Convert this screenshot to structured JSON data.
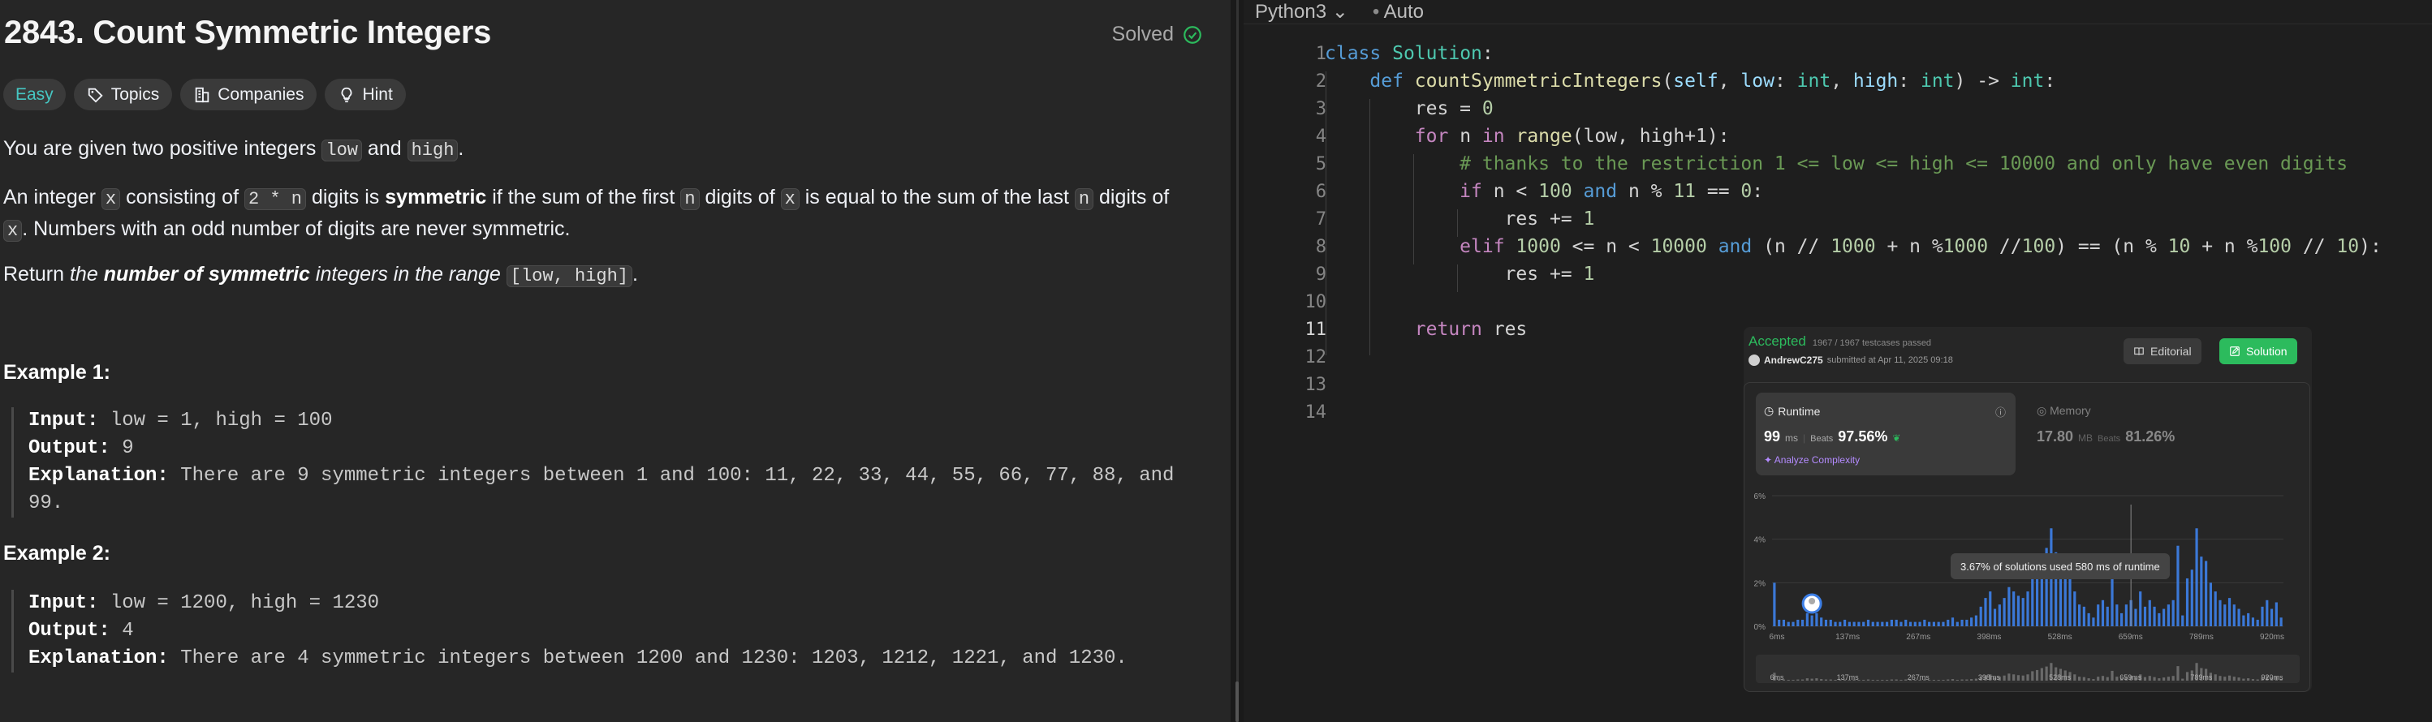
{
  "problem": {
    "title": "2843. Count Symmetric Integers",
    "solved_label": "Solved",
    "tags": {
      "difficulty": "Easy",
      "topics": "Topics",
      "companies": "Companies",
      "hint": "Hint"
    },
    "desc1": {
      "t1": "You are given two positive integers ",
      "c1": "low",
      "t2": " and ",
      "c2": "high",
      "t3": "."
    },
    "desc2": {
      "t1": "An integer ",
      "c1": "x",
      "t2": " consisting of ",
      "c2": "2 * n",
      "t3": " digits is ",
      "b1": "symmetric",
      "t4": " if the sum of the first ",
      "c3": "n",
      "t5": " digits of ",
      "c4": "x",
      "t6": " is equal to the sum of the last ",
      "c5": "n",
      "t7": " digits of ",
      "c6": "x",
      "t8": ". Numbers with an odd number of digits are never symmetric."
    },
    "desc3": {
      "t1": "Return ",
      "i1": "the ",
      "b1": "number of symmetric",
      "i2": " integers in the range ",
      "c1": "[low, high]",
      "t2": "."
    },
    "examples": [
      {
        "heading": "Example 1:",
        "input_label": "Input:",
        "input": " low = 1, high = 100",
        "output_label": "Output:",
        "output": " 9",
        "expl_label": "Explanation:",
        "expl": " There are 9 symmetric integers between 1 and 100: 11, 22, 33, 44, 55, 66, 77, 88, and",
        "expl2": "99."
      },
      {
        "heading": "Example 2:",
        "input_label": "Input:",
        "input": " low = 1200, high = 1230",
        "output_label": "Output:",
        "output": " 4",
        "expl_label": "Explanation:",
        "expl": " There are 4 symmetric integers between 1200 and 1230: 1203, 1212, 1221, and 1230."
      }
    ]
  },
  "editor": {
    "language": "Python3",
    "mode": "Auto",
    "line_numbers": [
      "1",
      "2",
      "3",
      "4",
      "5",
      "6",
      "7",
      "8",
      "9",
      "10",
      "11",
      "12",
      "13",
      "14"
    ],
    "current_line": "11",
    "code": {
      "l1": {
        "kw": "class",
        "name": "Solution",
        "rest": ":"
      },
      "l2": {
        "kw": "def",
        "fn": "countSymmetricIntegers",
        "p1": "self",
        "p2": "low",
        "t": "int",
        "p3": "high",
        "arrow": "->"
      },
      "l3": {
        "a": "res = ",
        "n": "0"
      },
      "l4": {
        "kw": "for",
        "v": "n",
        "kin": "in",
        "fn": "range",
        "args": "(low, high+1):"
      },
      "l5": {
        "cm": "# thanks to the restriction 1 <= low <= high <= 10000 and only have even digits"
      },
      "l6": {
        "kw": "if",
        "a": "n < ",
        "n1": "100",
        "op": "and",
        "b": "n % ",
        "n2": "11",
        "c": " == ",
        "n3": "0",
        "d": ":"
      },
      "l7": {
        "a": "res += ",
        "n": "1"
      },
      "l8": {
        "kw": "elif",
        "n1": "1000",
        "a": " <= n < ",
        "n2": "10000",
        "op": "and",
        "b": "(n // ",
        "n3": "1000",
        "c": " + n %",
        "n4": "1000",
        "d": " //",
        "n5": "100",
        "e": ") == (n % ",
        "n6": "10",
        "f": " + n %",
        "n7": "100",
        "g": " // ",
        "n8": "10",
        "h": "):"
      },
      "l9": {
        "a": "res += ",
        "n": "1"
      },
      "l11": {
        "kw": "return",
        "v": "res"
      }
    }
  },
  "result": {
    "status": "Accepted",
    "testcases": "1967 / 1967 testcases passed",
    "user": "AndrewC275",
    "submitted": "submitted at Apr 11, 2025 09:18",
    "editorial_label": "Editorial",
    "solution_label": "Solution",
    "runtime": {
      "label": "Runtime",
      "value": "99",
      "unit": "ms",
      "beats_label": "Beats",
      "beats": "97.56%",
      "analyze": "Analyze Complexity"
    },
    "memory": {
      "label": "Memory",
      "value": "17.80",
      "unit": "MB",
      "beats_label": "Beats",
      "beats": "81.26%"
    },
    "tooltip": "3.67% of solutions used 580 ms of runtime",
    "colors": {
      "accent": "#2cbb5d",
      "bar": "#3d7fe6",
      "easy": "#46c6c2"
    }
  },
  "chart_data": {
    "type": "bar",
    "title": "",
    "xlabel": "",
    "ylabel": "",
    "y_ticks": [
      "6%",
      "4%",
      "2%",
      "0%"
    ],
    "ylim": [
      0,
      6
    ],
    "x_tick_labels": [
      "6ms",
      "137ms",
      "267ms",
      "398ms",
      "528ms",
      "659ms",
      "789ms",
      "920ms"
    ],
    "user_marker_bin": 8,
    "highlight_bin": 76,
    "values": [
      2.0,
      0.3,
      0.3,
      0.2,
      0.2,
      0.3,
      0.3,
      0.6,
      0.5,
      0.6,
      0.4,
      0.3,
      0.3,
      0.2,
      0.2,
      0.3,
      0.2,
      0.2,
      0.2,
      0.2,
      0.3,
      0.2,
      0.2,
      0.2,
      0.2,
      0.3,
      0.3,
      0.2,
      0.3,
      0.2,
      0.2,
      0.2,
      0.3,
      0.2,
      0.2,
      0.2,
      0.2,
      0.3,
      0.4,
      0.2,
      0.3,
      0.3,
      0.4,
      0.5,
      0.9,
      1.3,
      1.6,
      0.8,
      1.0,
      1.3,
      1.8,
      1.6,
      1.4,
      1.3,
      1.6,
      2.4,
      2.7,
      3.2,
      3.6,
      4.5,
      3.4,
      3.0,
      2.6,
      2.2,
      1.6,
      1.0,
      0.9,
      0.6,
      0.4,
      1.0,
      1.2,
      0.9,
      2.5,
      1.0,
      0.6,
      1.0,
      1.2,
      0.8,
      1.6,
      0.9,
      1.2,
      0.9,
      0.6,
      0.8,
      1.0,
      1.2,
      3.7,
      0.5,
      2.2,
      2.6,
      4.5,
      3.2,
      3.0,
      2.0,
      1.6,
      1.2,
      1.0,
      1.3,
      1.0,
      0.8,
      0.5,
      0.6,
      0.4,
      0.3,
      0.9,
      1.2,
      0.8,
      1.1,
      0.4
    ]
  }
}
